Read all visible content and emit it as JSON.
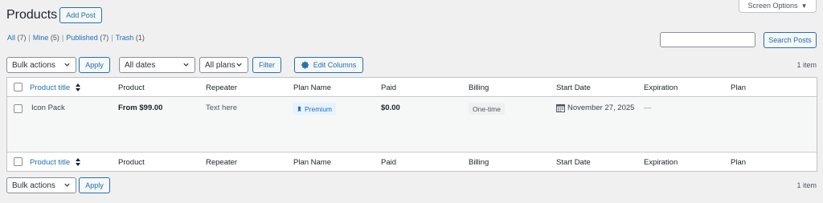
{
  "page": {
    "title": "Products",
    "add_post_label": "Add Post",
    "screen_options_label": "Screen Options"
  },
  "filters_views": [
    {
      "label": "All",
      "count": "(7)"
    },
    {
      "label": "Mine",
      "count": "(5)"
    },
    {
      "label": "Published",
      "count": "(7)"
    },
    {
      "label": "Trash",
      "count": "(1)"
    }
  ],
  "search": {
    "placeholder": "",
    "button_label": "Search Posts"
  },
  "toolbar_top": {
    "bulk_actions": "Bulk actions",
    "apply": "Apply",
    "dates": "All dates",
    "plans": "All plans",
    "filter": "Filter",
    "edit_columns": "Edit Columns",
    "item_count": "1 item"
  },
  "table": {
    "columns": [
      "Product title",
      "Product",
      "Repeater",
      "Plan Name",
      "Paid",
      "Billing",
      "Start Date",
      "Expiration",
      "Plan"
    ],
    "rows": [
      {
        "product_title": "Icon Pack",
        "product": "From $99.00",
        "repeater": "Text here",
        "plan_name": "Premium",
        "paid": "$0.00",
        "billing": "One-time",
        "start_date": "November 27, 2025",
        "expiration": "—",
        "plan": ""
      }
    ]
  },
  "toolbar_bottom": {
    "bulk_actions": "Bulk actions",
    "apply": "Apply",
    "item_count": "1 item"
  },
  "colors": {
    "accent": "#2271b1",
    "background": "#f0f0f1",
    "border": "#c3c4c7"
  },
  "icons": [
    "sort-icon",
    "gear-icon",
    "chevron-down-icon",
    "calendar-icon",
    "premium-icon",
    "triangle-down-icon"
  ]
}
